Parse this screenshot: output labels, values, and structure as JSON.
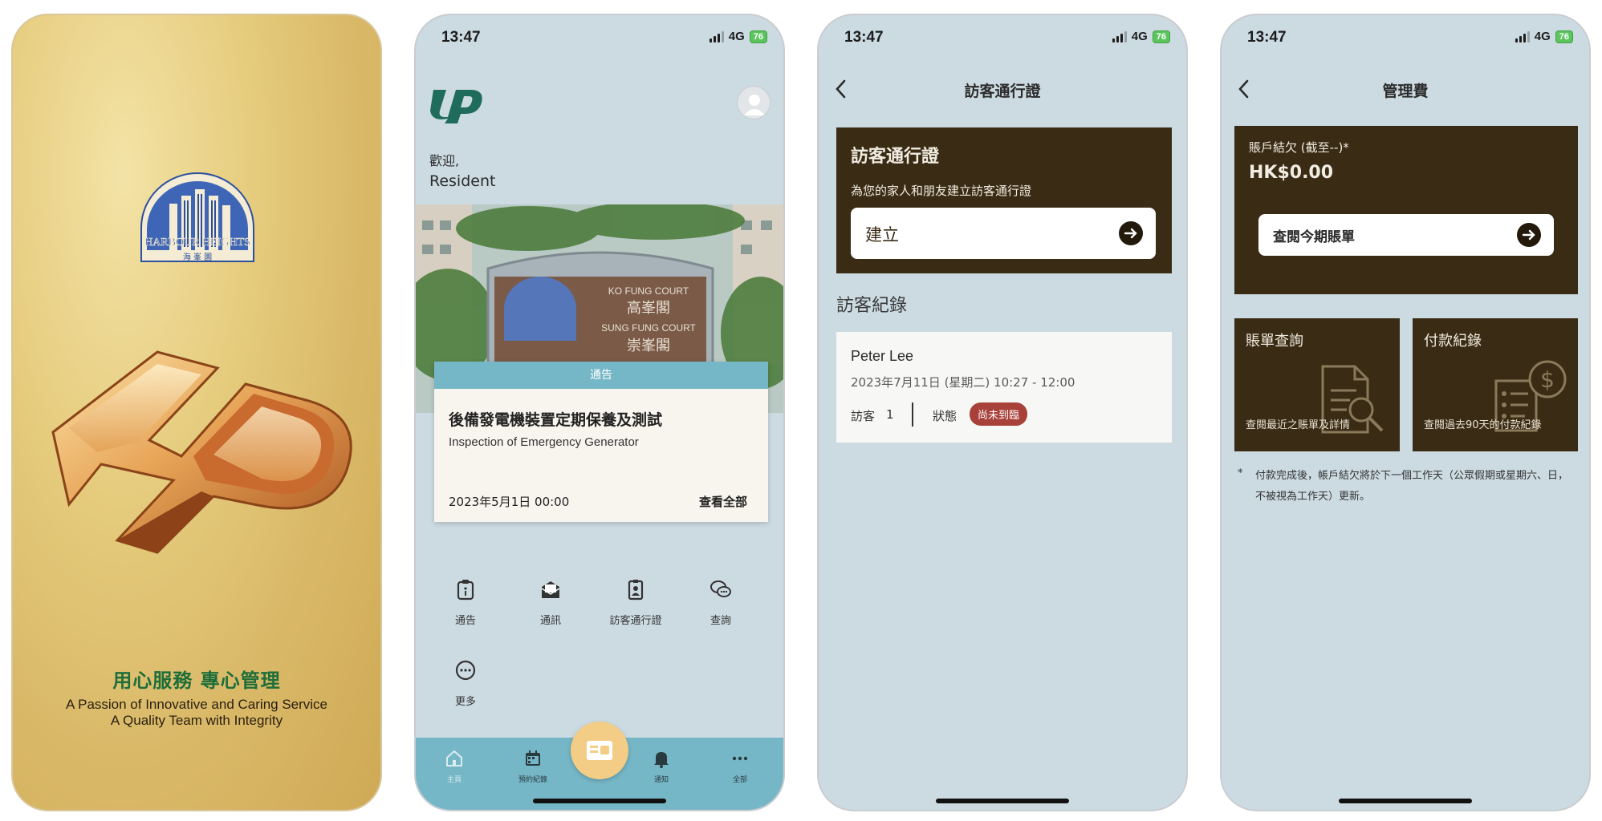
{
  "status": {
    "time": "13:47",
    "network": "4G",
    "battery": "76"
  },
  "splash": {
    "arch_text": "HARBOUR HEIGHTS",
    "arch_text_cn": "海 峯 園",
    "slogan_cn": "用心服務  專心管理",
    "slogan_en_1": "A Passion of Innovative and Caring Service",
    "slogan_en_2": "A Quality Team with Integrity"
  },
  "home": {
    "welcome": "歡迎,",
    "user": "Resident",
    "sign_lines": [
      "KO FUNG COURT",
      "高峯閣",
      "SUNG FUNG COURT",
      "崇峯閣"
    ],
    "notice": {
      "header": "通告",
      "title": "後備發電機裝置定期保養及測試",
      "subtitle": "Inspection of Emergency Generator",
      "date": "2023年5月1日 00:00",
      "view_all": "查看全部"
    },
    "menu": [
      {
        "label": "通告",
        "icon": "clipboard-notice-icon"
      },
      {
        "label": "通訊",
        "icon": "mail-icon"
      },
      {
        "label": "訪客通行證",
        "icon": "visitor-badge-icon"
      },
      {
        "label": "查詢",
        "icon": "chat-bubbles-icon"
      },
      {
        "label": "更多",
        "icon": "more-circle-icon"
      }
    ],
    "tabs": [
      {
        "label": "主頁",
        "icon": "home-icon"
      },
      {
        "label": "預約紀錄",
        "icon": "calendar-icon"
      },
      {
        "label": "通知",
        "icon": "bell-icon"
      },
      {
        "label": "全部",
        "icon": "more-dots-icon"
      }
    ],
    "colors": {
      "accent": "#76b7c7",
      "fab": "#f3cd85"
    }
  },
  "visitor": {
    "nav_title": "訪客通行證",
    "card_title": "訪客通行證",
    "card_desc": "為您的家人和朋友建立訪客通行證",
    "create_label": "建立",
    "records_title": "訪客紀錄",
    "record": {
      "name": "Peter Lee",
      "time": "2023年7月11日 (星期二) 10:27 - 12:00",
      "visitors_label": "訪客",
      "visitors_count": "1",
      "status_label": "狀態",
      "status_value": "尚未到臨"
    }
  },
  "fees": {
    "nav_title": "管理費",
    "balance_label": "賬戶結欠 (截至--)*",
    "balance_value": "HK$0.00",
    "view_bill": "查閱今期賬單",
    "bill_query_title": "賬單查詢",
    "bill_query_desc": "查閱最近之賬單及詳情",
    "payment_title": "付款紀錄",
    "payment_desc": "查閱過去90天的付款紀錄",
    "footnote_mark": "*",
    "footnote": "付款完成後，帳戶結欠將於下一個工作天（公眾假期或星期六、日，不被視為工作天）更新。"
  }
}
